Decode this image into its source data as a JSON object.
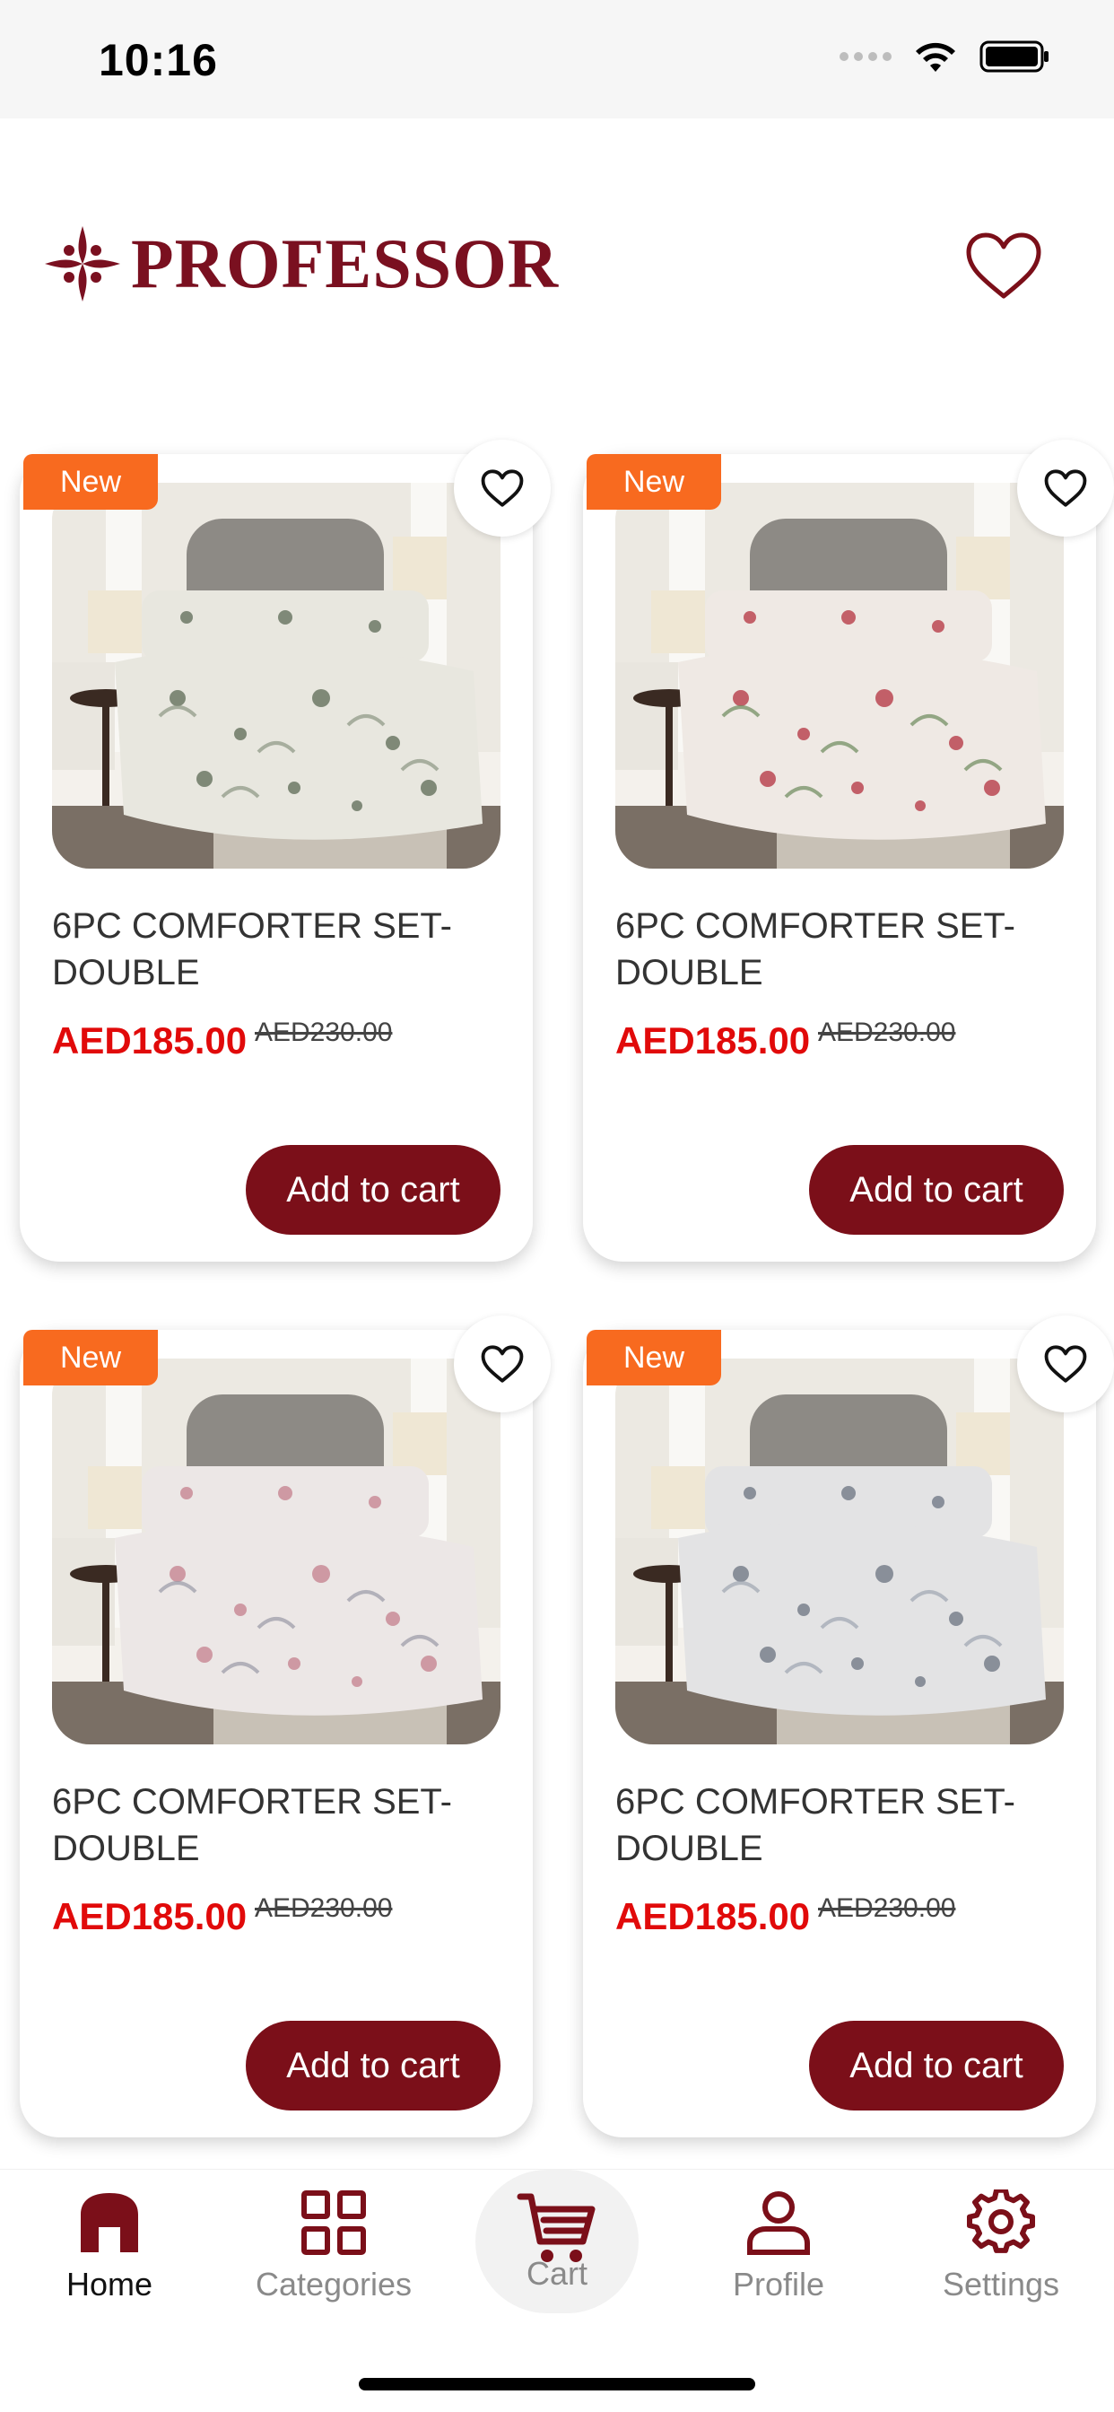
{
  "status_bar": {
    "time": "10:16"
  },
  "header": {
    "brand": "PROFESSOR"
  },
  "products": [
    {
      "badge": "New",
      "title": "6PC COMFORTER SET- DOUBLE",
      "price": "AED185.00",
      "old_price": "AED230.00",
      "cta": "Add to cart",
      "pattern": "gray-green floral"
    },
    {
      "badge": "New",
      "title": "6PC COMFORTER SET- DOUBLE",
      "price": "AED185.00",
      "old_price": "AED230.00",
      "cta": "Add to cart",
      "pattern": "red floral"
    },
    {
      "badge": "New",
      "title": "6PC COMFORTER SET- DOUBLE",
      "price": "AED185.00",
      "old_price": "AED230.00",
      "cta": "Add to cart",
      "pattern": "pink blossom"
    },
    {
      "badge": "New",
      "title": "6PC COMFORTER SET- DOUBLE",
      "price": "AED185.00",
      "old_price": "AED230.00",
      "cta": "Add to cart",
      "pattern": "gray floral"
    }
  ],
  "tabbar": {
    "items": [
      {
        "label": "Home",
        "icon": "home-icon",
        "active": true
      },
      {
        "label": "Categories",
        "icon": "grid-icon",
        "active": false
      },
      {
        "label": "Cart",
        "icon": "cart-icon",
        "active": false
      },
      {
        "label": "Profile",
        "icon": "user-icon",
        "active": false
      },
      {
        "label": "Settings",
        "icon": "gear-icon",
        "active": false
      }
    ]
  },
  "colors": {
    "brand": "#7b0f19",
    "price": "#e10a0a",
    "badge": "#f86a1f"
  }
}
